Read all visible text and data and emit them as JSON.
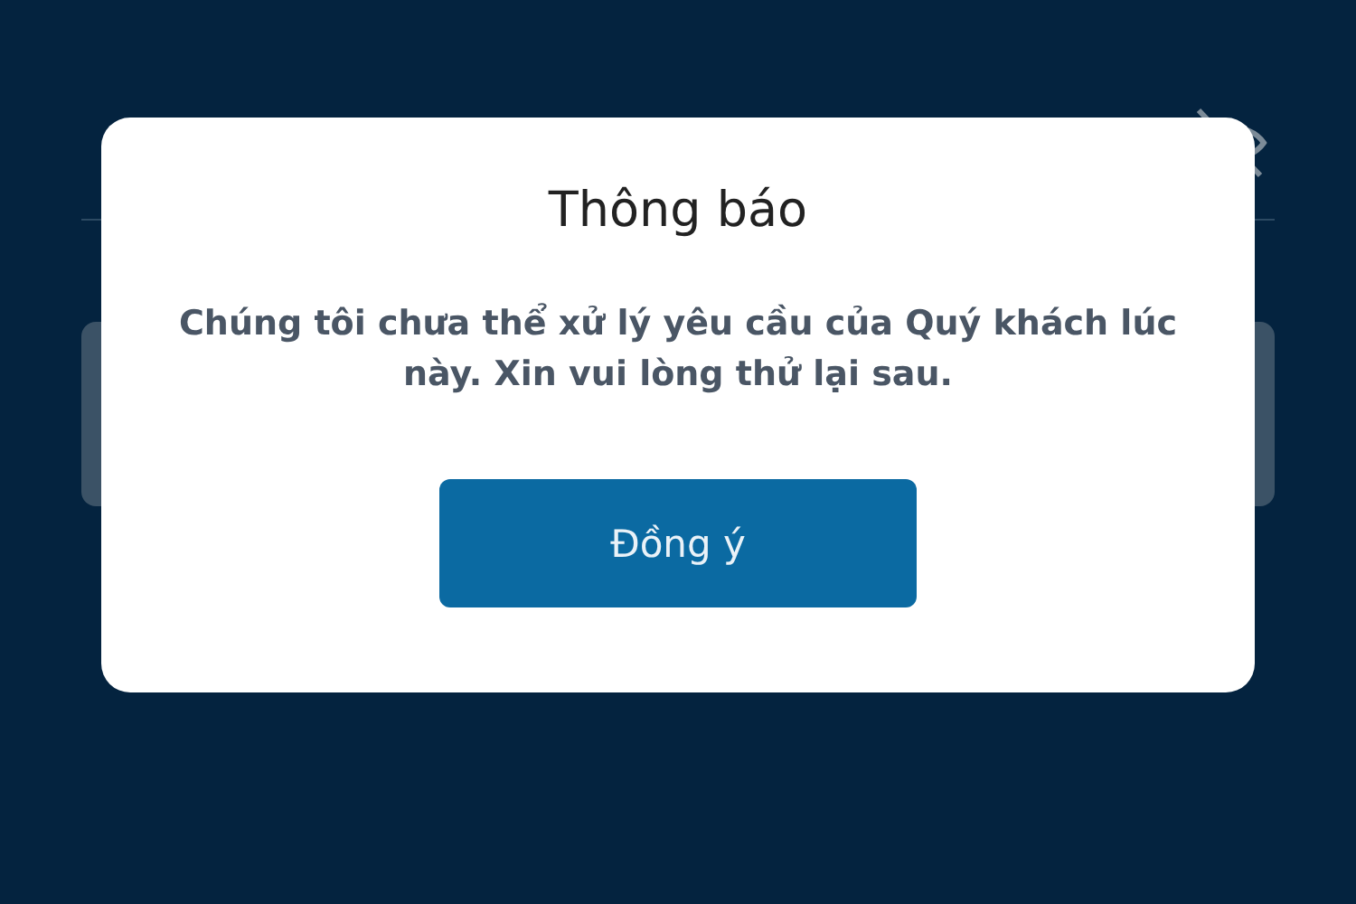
{
  "dialog": {
    "title": "Thông báo",
    "message": "Chúng tôi chưa thể xử lý yêu cầu của Quý khách lúc này. Xin vui lòng thử lại sau.",
    "buttons": [
      "Đồng ý"
    ]
  }
}
